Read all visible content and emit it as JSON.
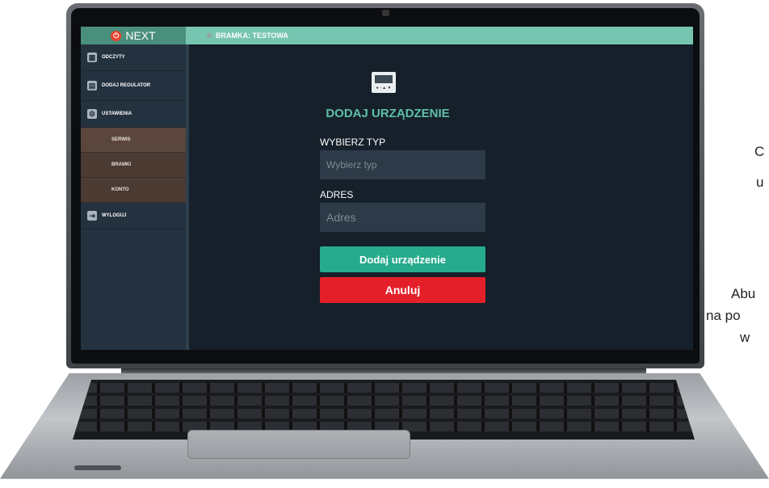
{
  "app": {
    "logo": "NEXT",
    "gateway_label": "BRAMKA: TESTOWA"
  },
  "sidebar": {
    "items": [
      {
        "label": "ODCZYTY"
      },
      {
        "label": "DODAJ REGULATOR"
      },
      {
        "label": "USTAWIENIA"
      }
    ],
    "sub_items": [
      {
        "label": "SERWIS"
      },
      {
        "label": "BRAMKI"
      },
      {
        "label": "KONTO"
      }
    ],
    "logout": {
      "label": "WYLOGUJ"
    }
  },
  "form": {
    "title": "DODAJ URZĄDZENIE",
    "type": {
      "label": "WYBIERZ TYP",
      "placeholder": "Wybierz typ"
    },
    "address": {
      "label": "ADRES",
      "placeholder": "Adres"
    },
    "add_button": "Dodaj urządzenie",
    "cancel_button": "Anuluj"
  },
  "cropped_text": {
    "line1": "C",
    "line2": "u",
    "line3": "Abu",
    "line4": "na po",
    "line5": "w"
  },
  "colors": {
    "topbar": "#77c5b0",
    "accent": "#27ab8d",
    "cancel": "#e3202a",
    "screen_bg": "#15202a"
  }
}
